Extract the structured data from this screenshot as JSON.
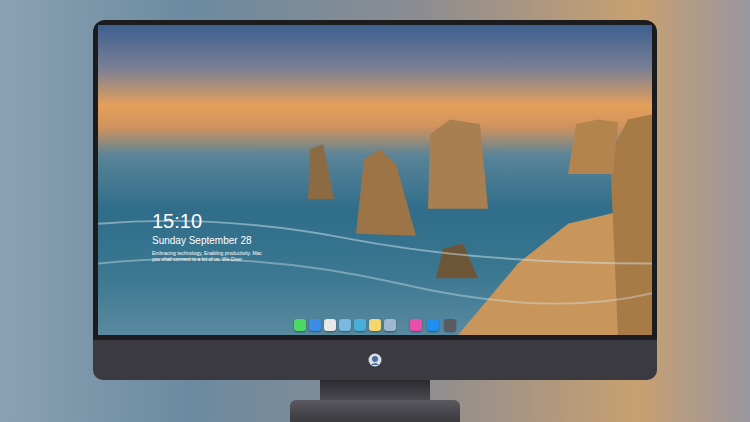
{
  "lock_screen": {
    "time": "15:10",
    "date": "Sunday September 28",
    "message": [
      "Embracing technology, Enabling productivity. Mac",
      "you shall connect to a lot of us. We-Deer"
    ]
  },
  "dock": {
    "apps": [
      {
        "color": "#4cd964"
      },
      {
        "color": "#3a8ee6"
      },
      {
        "color": "#e8e8e8"
      },
      {
        "color": "#7ab8e0"
      },
      {
        "color": "#48b0d8"
      },
      {
        "color": "#f5d76e"
      },
      {
        "color": "#9fb8d0"
      }
    ],
    "pinned": [
      {
        "color": "#e94fa8"
      },
      {
        "color": "#1f8ef1"
      },
      {
        "color": "#5a5a60"
      }
    ]
  }
}
